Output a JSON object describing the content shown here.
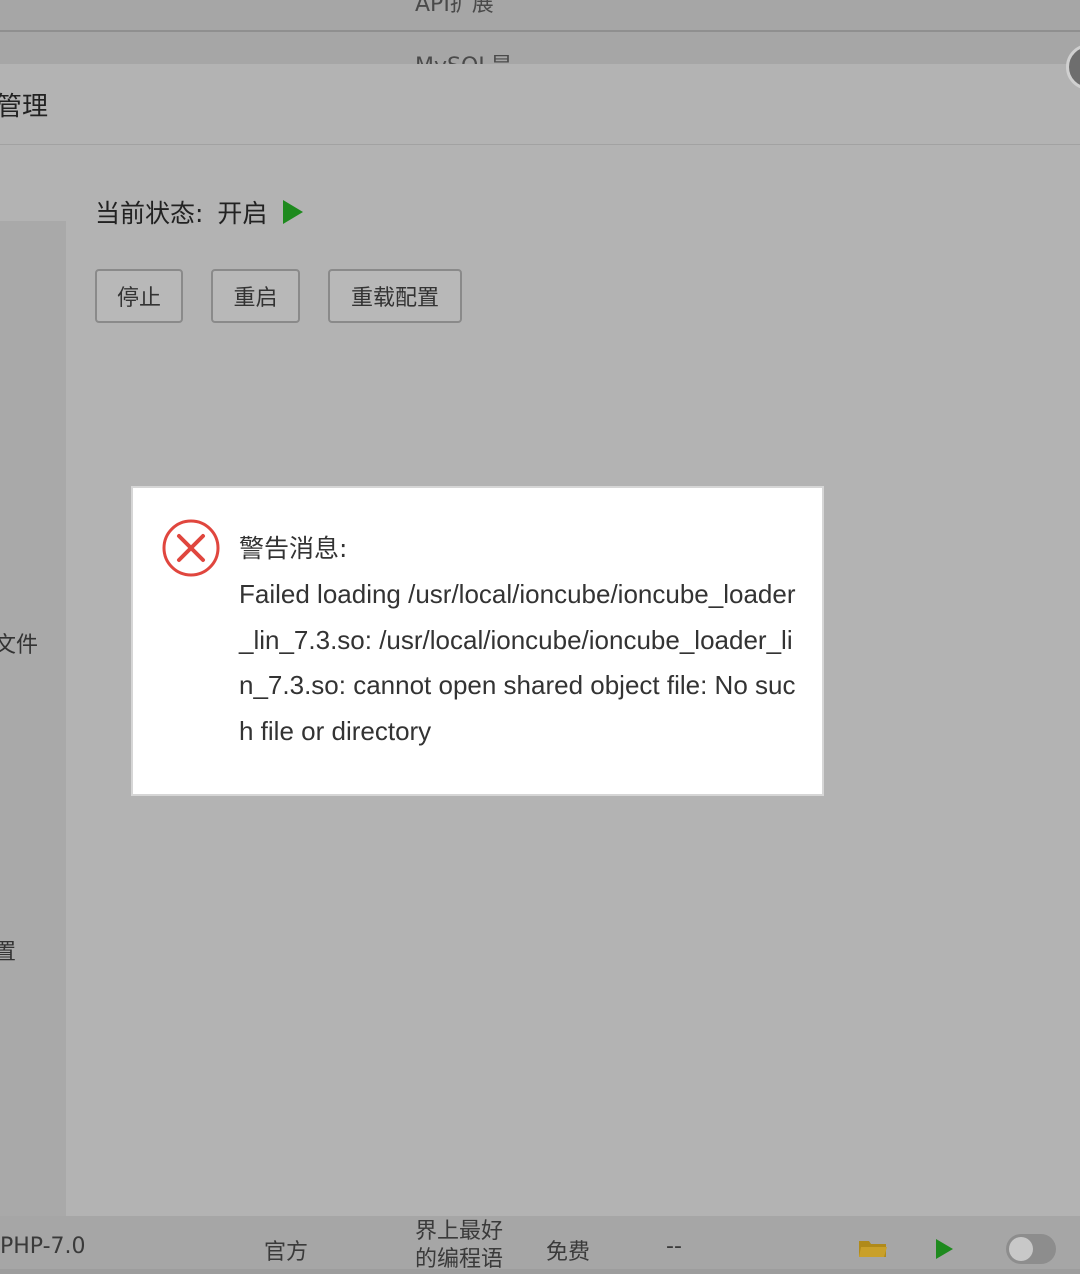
{
  "background_list": {
    "row1_label": "API扩展",
    "row2_label": "MySQL是"
  },
  "modal": {
    "title": "管理",
    "status_label": "当前状态:",
    "status_value": "开启",
    "buttons": [
      "停止",
      "重启",
      "重载配置"
    ],
    "sidebar": {
      "item_files": "文件",
      "item_config": "置"
    }
  },
  "alert": {
    "heading": "警告消息:",
    "message": "Failed loading /usr/local/ioncube/ioncube_loader_lin_7.3.so: /usr/local/ioncube/ioncube_loader_lin_7.3.so: cannot open shared object file: No such file or directory",
    "icon": "error-circle-x-icon"
  },
  "bottom_row": {
    "name": "PHP-7.0",
    "developer": "官方",
    "description": "界上最好的编程语",
    "price": "免费",
    "expiry": "--",
    "icons": [
      "folder-icon",
      "play-icon",
      "toggle-switch"
    ]
  },
  "colors": {
    "status_green": "#1e8a1e",
    "error_red": "#e0463e",
    "folder_yellow": "#b08a1a"
  }
}
